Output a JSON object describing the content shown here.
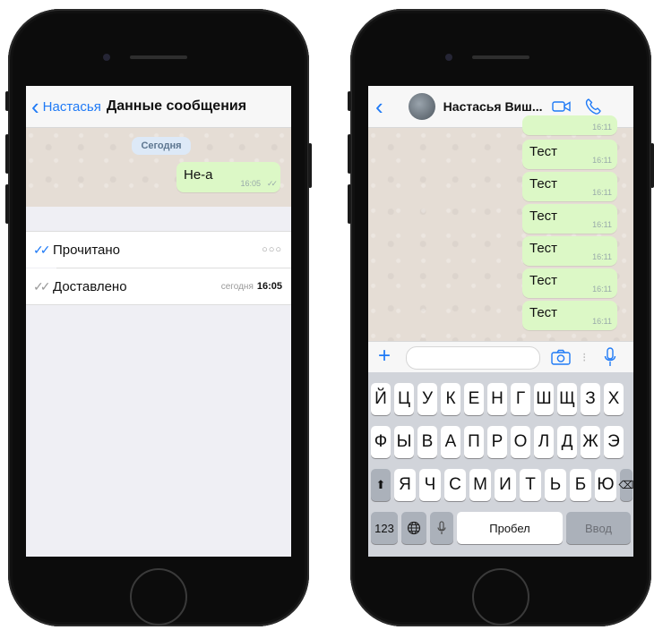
{
  "left_phone": {
    "nav": {
      "back_label": "Настасья",
      "title": "Данные сообщения"
    },
    "date_badge": "Сегодня",
    "message": {
      "text": "Не-а",
      "time": "16:05",
      "checks": "✓✓"
    },
    "rows": [
      {
        "icon": "✓✓",
        "label": "Прочитано",
        "value": "○○○"
      },
      {
        "icon": "✓✓",
        "label": "Доставлено",
        "value_prefix": "сегодня",
        "value": "16:05"
      }
    ]
  },
  "right_phone": {
    "nav": {
      "title": "Настасья Виш..."
    },
    "partial_time": "16:11",
    "messages": [
      {
        "text": "Тест",
        "time": "16:11"
      },
      {
        "text": "Тест",
        "time": "16:11"
      },
      {
        "text": "Тест",
        "time": "16:11"
      },
      {
        "text": "Тест",
        "time": "16:11"
      },
      {
        "text": "Тест",
        "time": "16:11"
      },
      {
        "text": "Тест",
        "time": "16:11"
      }
    ],
    "input_bar": {
      "plus": "+",
      "separator": "⁝"
    },
    "keyboard": {
      "row1": [
        "Й",
        "Ц",
        "У",
        "К",
        "Е",
        "Н",
        "Г",
        "Ш",
        "Щ",
        "З",
        "Х"
      ],
      "row2": [
        "Ф",
        "Ы",
        "В",
        "А",
        "П",
        "Р",
        "О",
        "Л",
        "Д",
        "Ж",
        "Э"
      ],
      "row3": [
        "Я",
        "Ч",
        "С",
        "М",
        "И",
        "Т",
        "Ь",
        "Б",
        "Ю"
      ],
      "shift": "⬆",
      "backspace": "⌫",
      "numbers_label": "123",
      "space_label": "Пробел",
      "return_label": "Ввод"
    }
  },
  "colors": {
    "accent_blue": "#1f7af6",
    "bubble_green": "#dcf8c6",
    "chat_bg": "#e5ddd5"
  }
}
